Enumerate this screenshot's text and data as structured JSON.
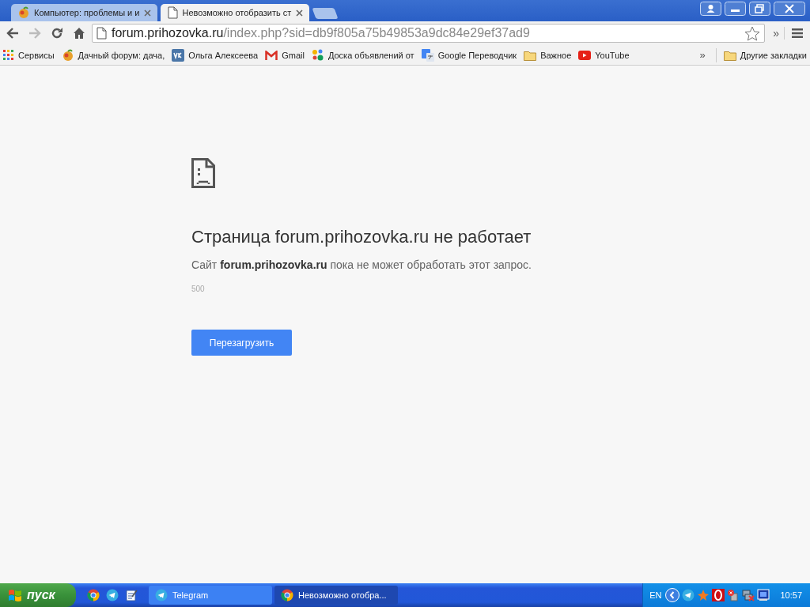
{
  "tabs": [
    {
      "title": "Компьютер: проблемы и и",
      "kind": "fruit",
      "selected": false
    },
    {
      "title": "Невозможно отобразить ст",
      "kind": "page",
      "selected": true
    }
  ],
  "address": {
    "host": "forum.prihozovka.ru",
    "path": "/index.php?sid=db9f805a75b49853a9dc84e29ef37ad9"
  },
  "bookmarks": [
    {
      "label": "Сервисы",
      "kind": "apps"
    },
    {
      "label": "Дачный форум: дача,",
      "kind": "fruit"
    },
    {
      "label": "Ольга Алексеева",
      "kind": "vk"
    },
    {
      "label": "Gmail",
      "kind": "gmail"
    },
    {
      "label": "Доска объявлений от",
      "kind": "dots"
    },
    {
      "label": "Google Переводчик",
      "kind": "translate"
    },
    {
      "label": "Важное",
      "kind": "folder"
    },
    {
      "label": "YouTube",
      "kind": "youtube"
    }
  ],
  "bookmarks_more": "»",
  "other_bookmarks": {
    "label": "Другие закладки",
    "kind": "folder"
  },
  "toolbar_more": "»",
  "error_page": {
    "title": "Страница forum.prihozovka.ru не работает",
    "message": "Сайт **forum.prihozovka.ru** пока не может обработать этот запрос.",
    "code": "500",
    "button": "Перезагрузить"
  },
  "taskbar": {
    "start": "пуск",
    "quick_launch": [
      {
        "kind": "chrome"
      },
      {
        "kind": "telegram"
      },
      {
        "kind": "notepad"
      }
    ],
    "tasks": [
      {
        "label": "Telegram",
        "kind": "telegram",
        "selected": false
      },
      {
        "label": "Невозможно отобра...",
        "kind": "chrome",
        "selected": true
      }
    ],
    "language": "EN",
    "tray": [
      {
        "kind": "arrow"
      },
      {
        "kind": "telegram"
      },
      {
        "kind": "avast"
      },
      {
        "kind": "opera"
      },
      {
        "kind": "usb"
      },
      {
        "kind": "network"
      },
      {
        "kind": "monitor"
      }
    ],
    "clock": "10:57"
  }
}
